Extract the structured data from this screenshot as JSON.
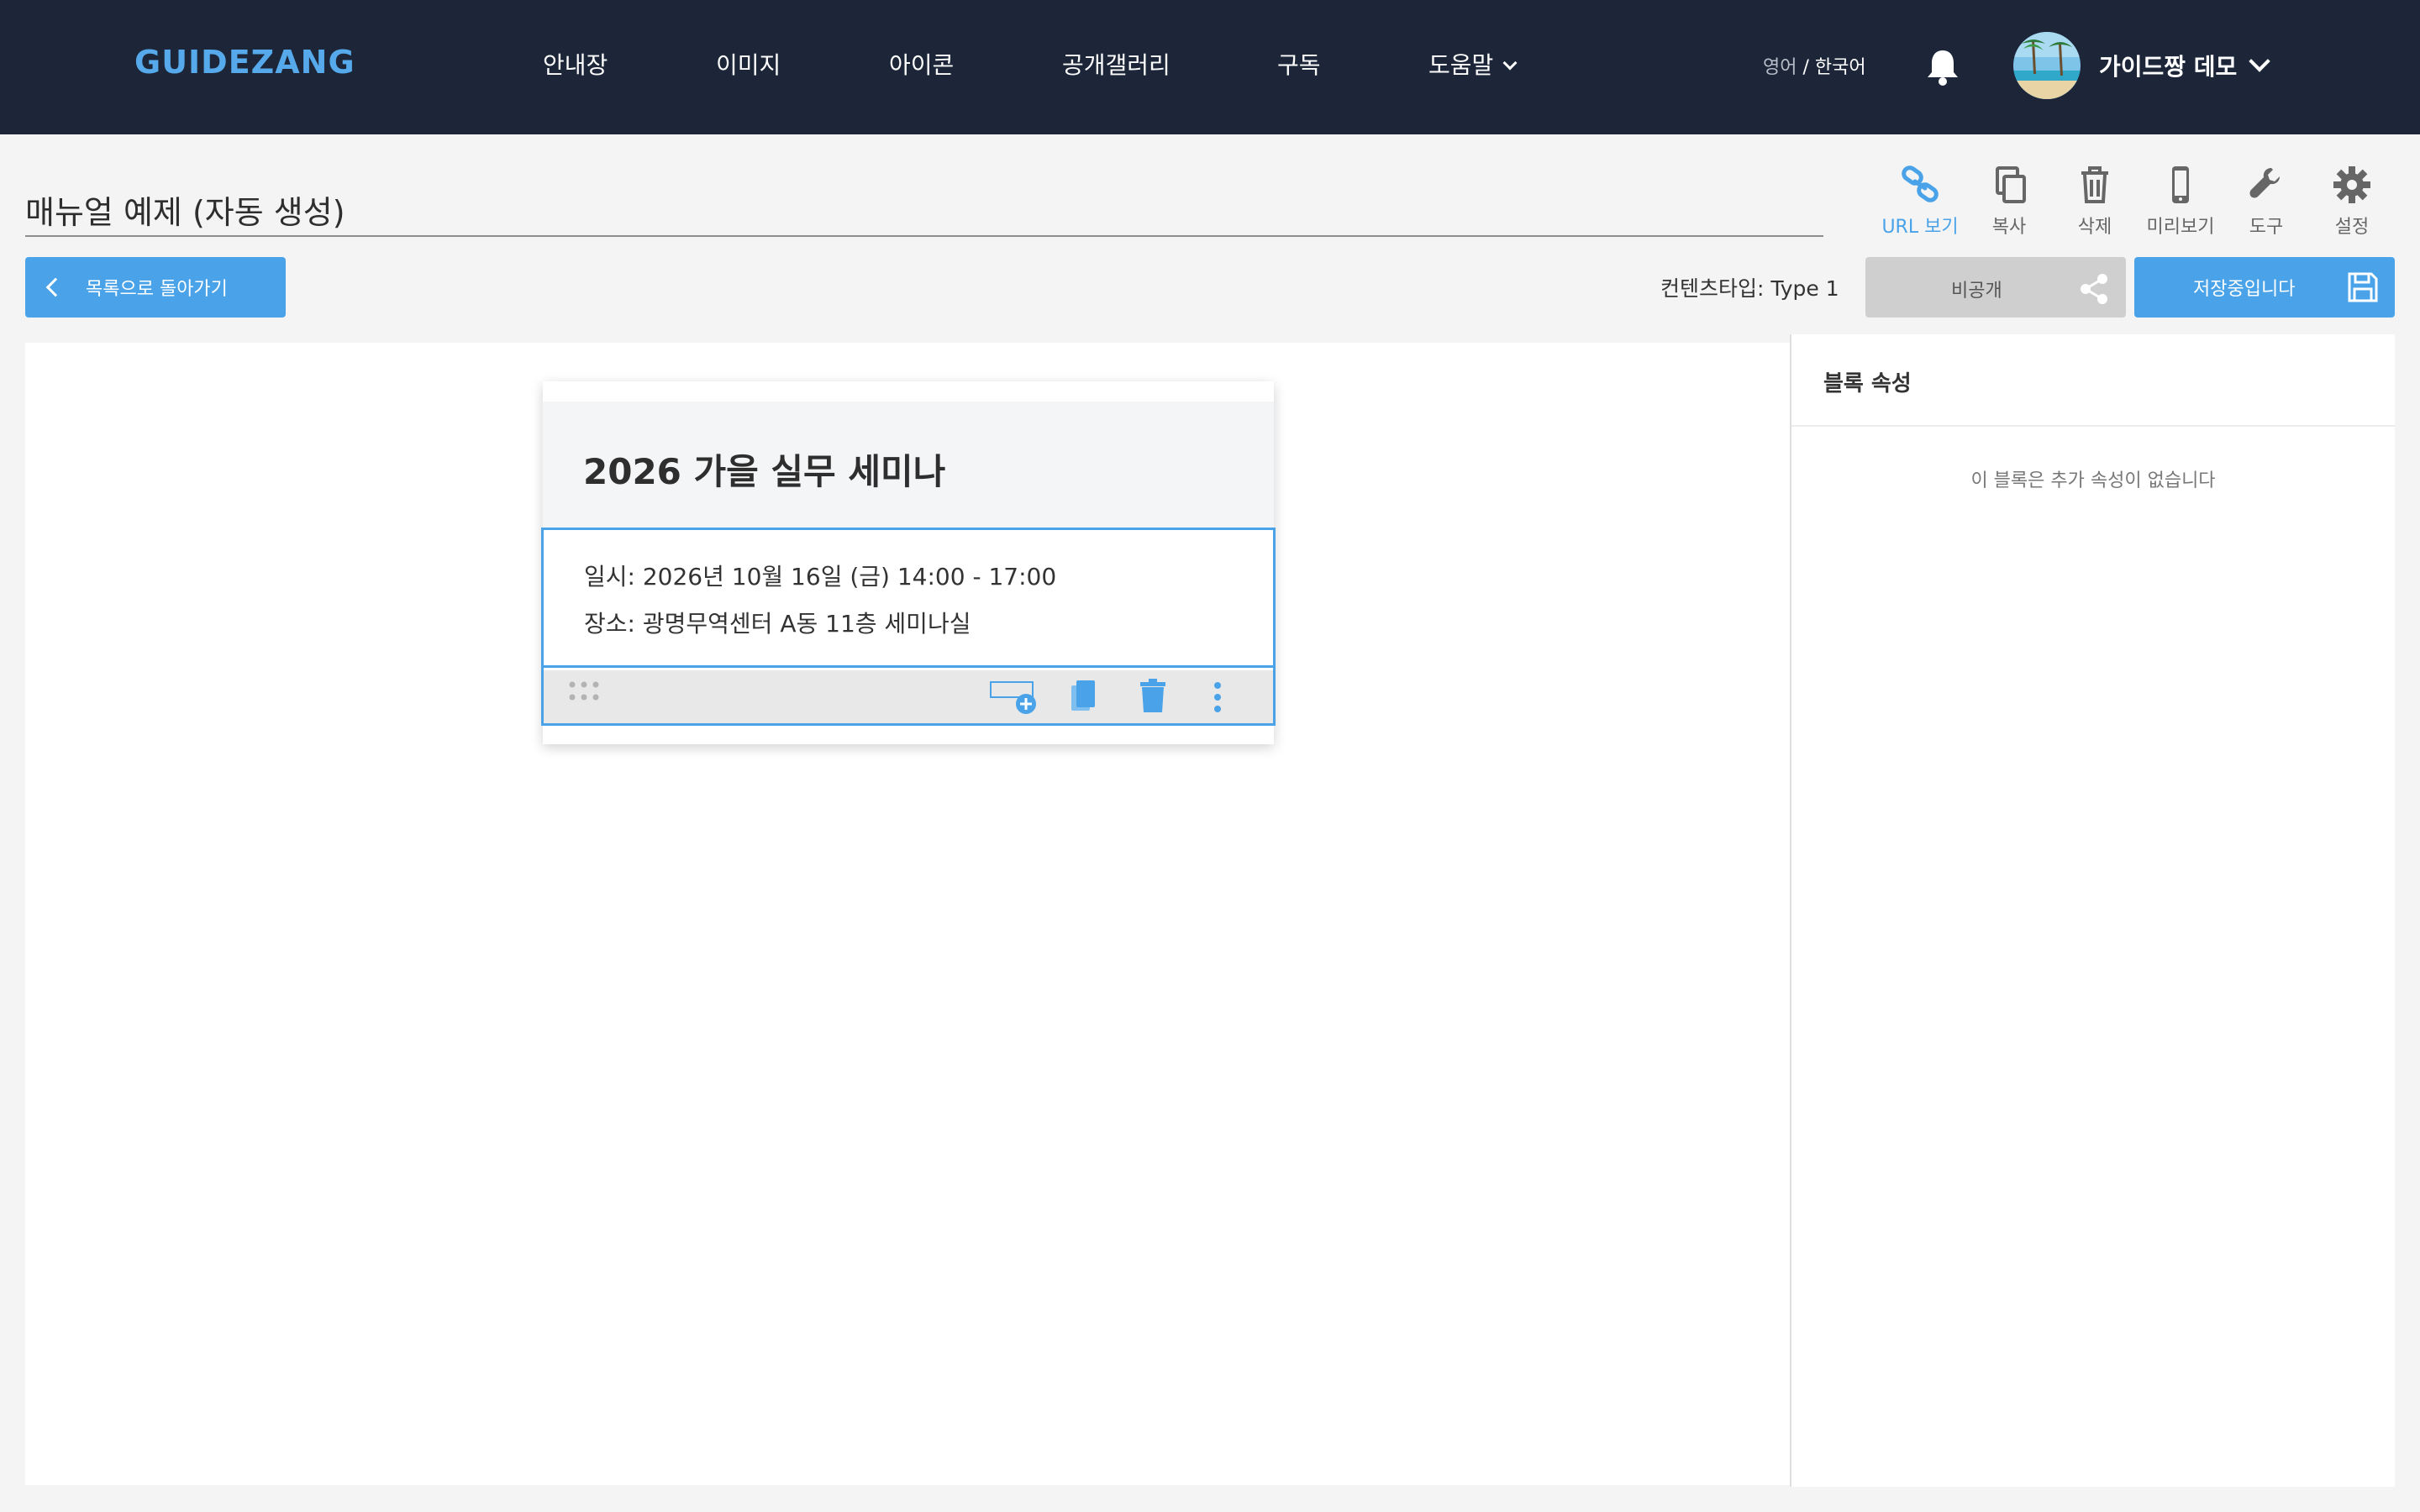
{
  "header": {
    "logo": "GUIDEZANG",
    "menu": [
      {
        "label": "안내장"
      },
      {
        "label": "이미지"
      },
      {
        "label": "아이콘"
      },
      {
        "label": "공개갤러리"
      },
      {
        "label": "구독"
      },
      {
        "label": "도움말"
      }
    ],
    "lang_inactive": "영어",
    "lang_sep": " / ",
    "lang_active": "한국어",
    "user_name": "가이드짱 데모",
    "icons": {
      "notifications": "bell-icon",
      "user_menu": "chevron-down-icon"
    }
  },
  "document": {
    "title": "매뉴얼 예제 (자동 생성)"
  },
  "toolbar": [
    {
      "label": "URL 보기",
      "icon": "link-icon"
    },
    {
      "label": "복사",
      "icon": "copy-icon"
    },
    {
      "label": "삭제",
      "icon": "trash-icon"
    },
    {
      "label": "미리보기",
      "icon": "mobile-icon"
    },
    {
      "label": "도구",
      "icon": "wrench-icon"
    },
    {
      "label": "설정",
      "icon": "gear-icon"
    }
  ],
  "actions": {
    "back_label": "목록으로 돌아가기",
    "content_type": "컨텐츠타입: Type 1",
    "visibility_label": "비공개",
    "save_label": "저장중입니다"
  },
  "card": {
    "title": "2026 가을 실무 세미나",
    "lines": [
      "일시: 2026년 10월 16일 (금) 14:00 - 17:00",
      "장소: 광명무역센터 A동 11층 세미나실"
    ],
    "block_tools": [
      "add-block-icon",
      "duplicate-icon",
      "trash-icon",
      "more-vertical-icon"
    ]
  },
  "panel": {
    "title": "블록 속성",
    "empty_message": "이 블록은 추가 속성이 없습니다"
  },
  "colors": {
    "nav_bg": "#1c2638",
    "accent": "#4aa3e8",
    "logo": "#56a9ea"
  }
}
